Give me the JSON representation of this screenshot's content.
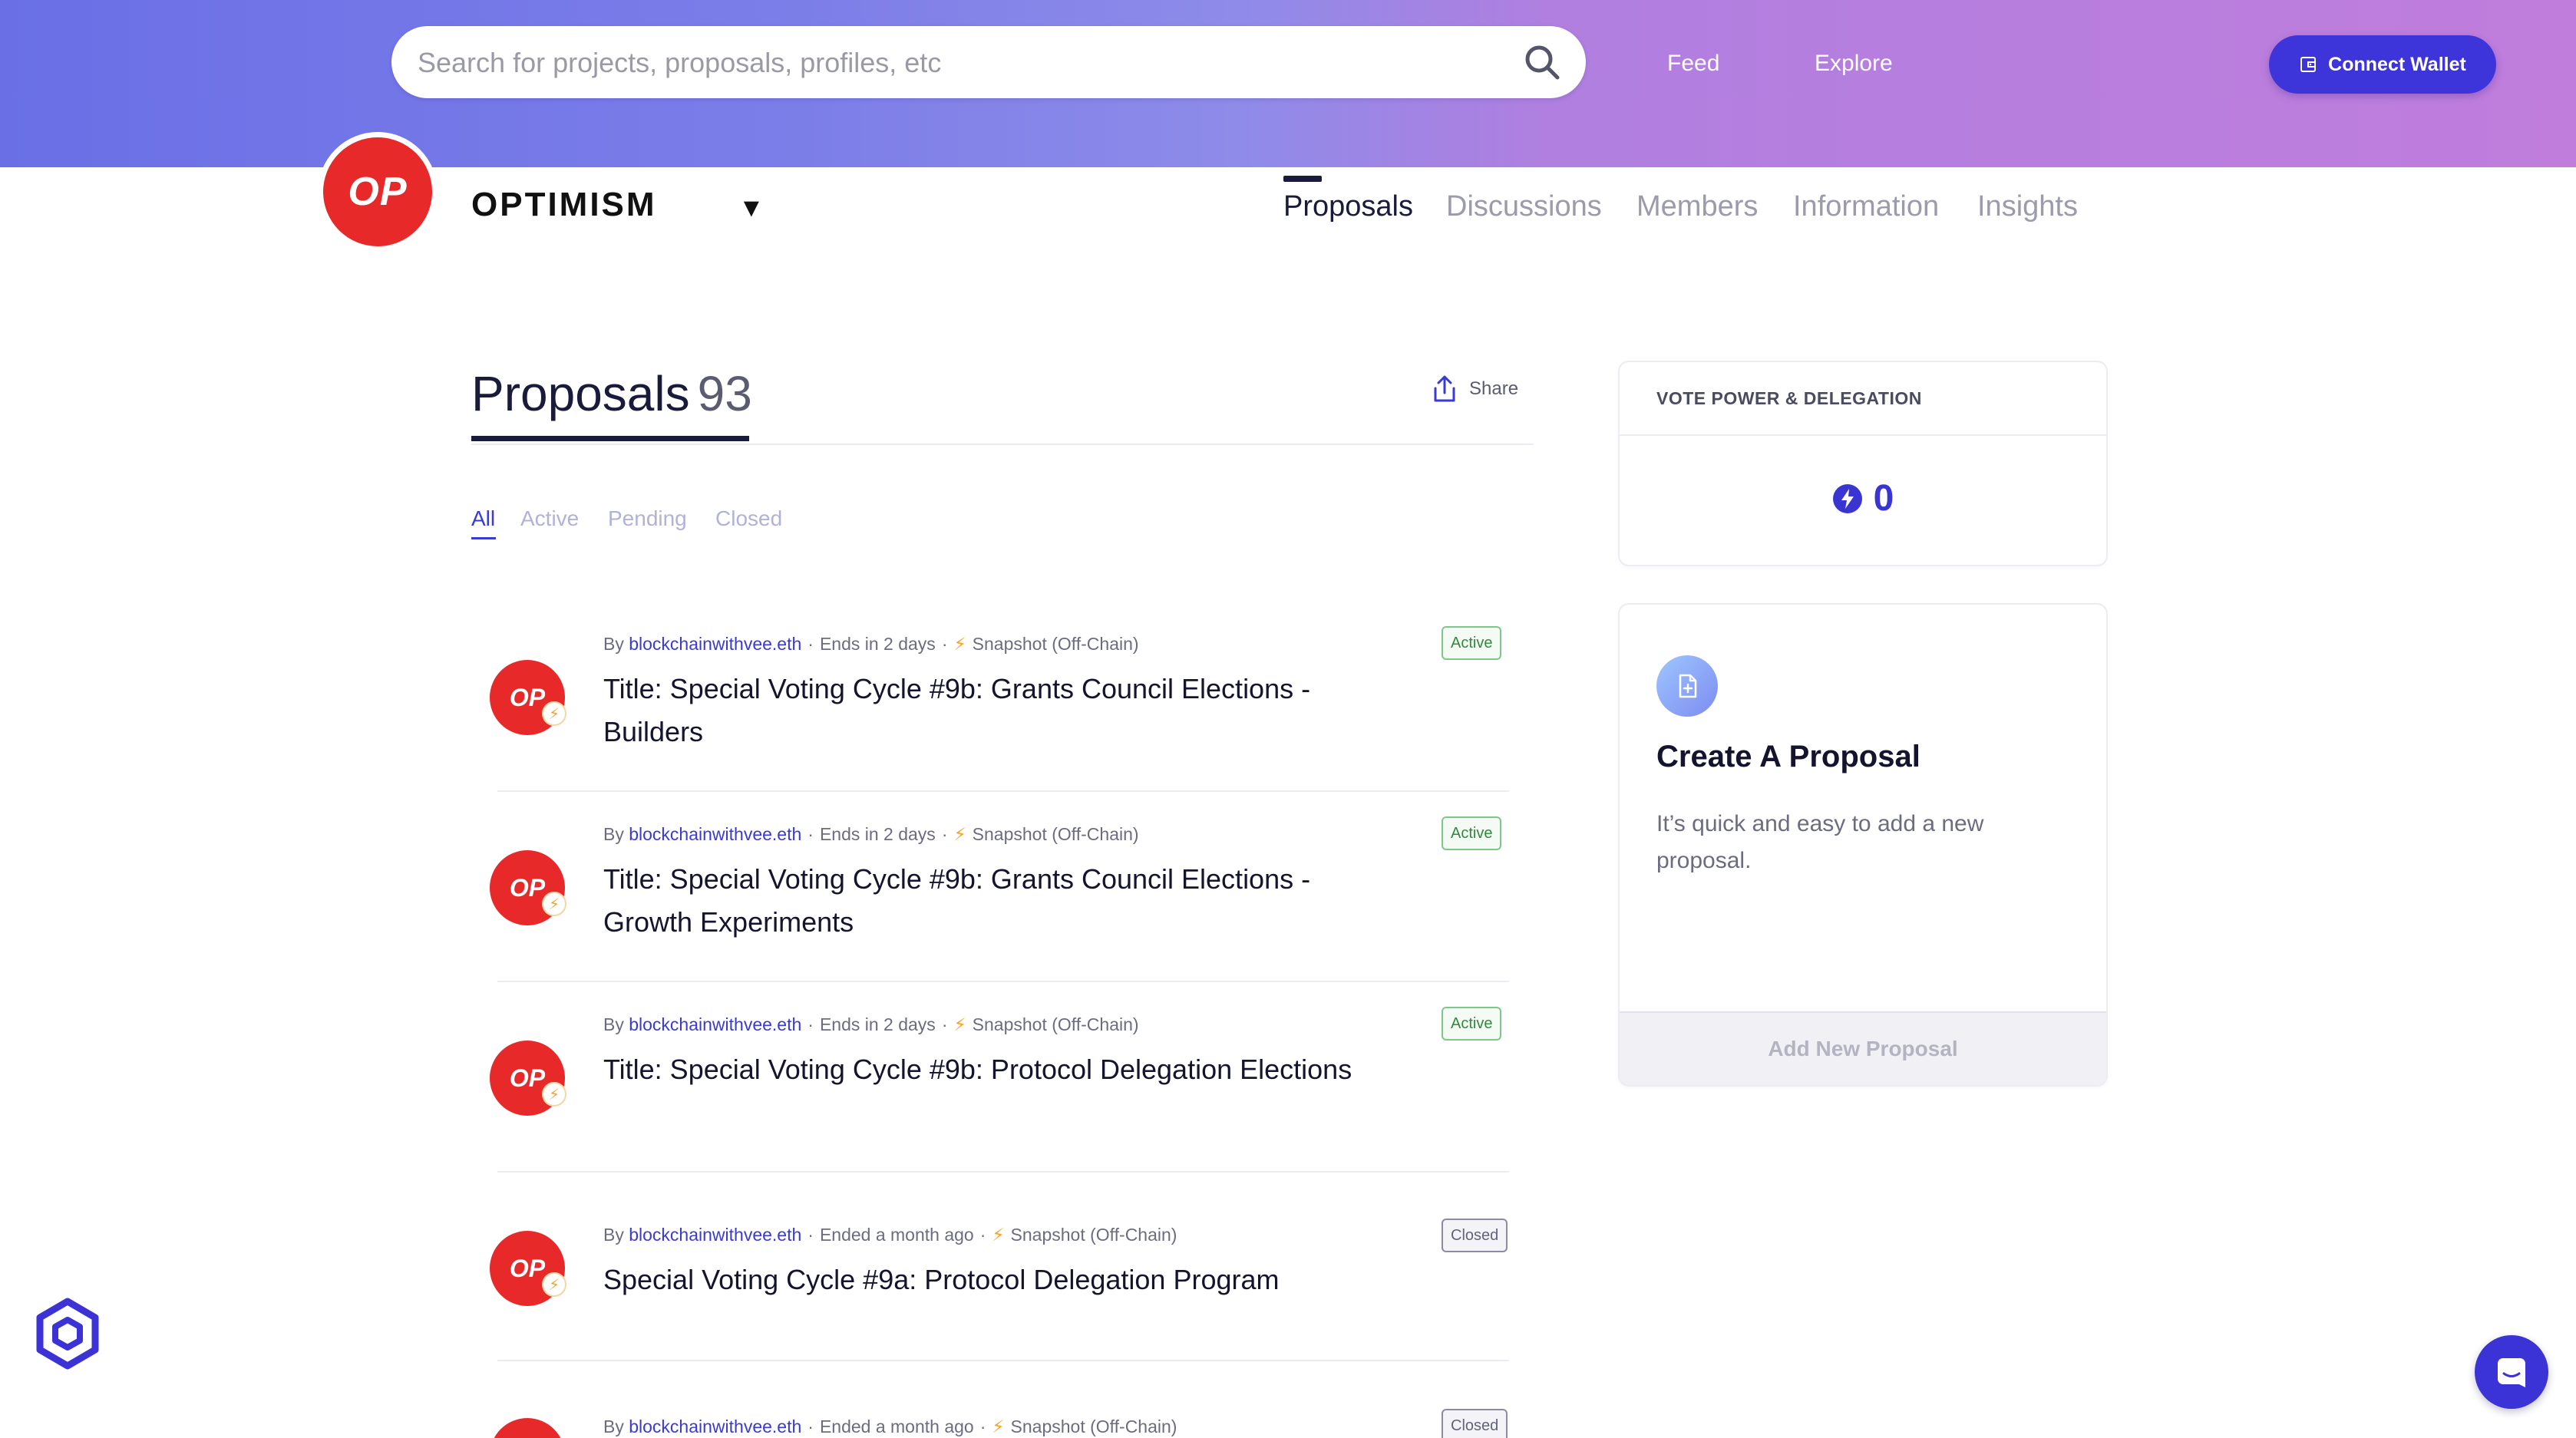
{
  "header": {
    "search_placeholder": "Search for projects, proposals, profiles, etc",
    "nav": [
      "Feed",
      "Explore"
    ],
    "connect_wallet": "Connect Wallet",
    "gradient_colors": [
      "#6a6fe6",
      "#c07ddc"
    ]
  },
  "org": {
    "logo_text": "OP",
    "name": "OPTIMISM",
    "caret": "▼",
    "tabs": [
      "Proposals",
      "Discussions",
      "Members",
      "Information",
      "Insights"
    ],
    "active_tab": "Proposals",
    "brand_color": "#e8292a"
  },
  "proposals": {
    "title": "Proposals",
    "count": "93",
    "share_label": "Share",
    "filters": [
      "All",
      "Active",
      "Pending",
      "Closed"
    ],
    "active_filter": "All",
    "items": [
      {
        "avatar": "OP",
        "by": "By",
        "author": "blockchainwithvee.eth",
        "time": "Ends in 2 days",
        "source": "Snapshot (Off-Chain)",
        "title": "Title: Special Voting Cycle #9b: Grants Council Elections - Builders",
        "status": "Active"
      },
      {
        "avatar": "OP",
        "by": "By",
        "author": "blockchainwithvee.eth",
        "time": "Ends in 2 days",
        "source": "Snapshot (Off-Chain)",
        "title": "Title: Special Voting Cycle #9b: Grants Council Elections - Growth Experiments",
        "status": "Active"
      },
      {
        "avatar": "OP",
        "by": "By",
        "author": "blockchainwithvee.eth",
        "time": "Ends in 2 days",
        "source": "Snapshot (Off-Chain)",
        "title": "Title: Special Voting Cycle #9b: Protocol Delegation Elections",
        "status": "Active"
      },
      {
        "avatar": "OP",
        "by": "By",
        "author": "blockchainwithvee.eth",
        "time": "Ended a month ago",
        "source": "Snapshot (Off-Chain)",
        "title": "Special Voting Cycle #9a: Protocol Delegation Program",
        "status": "Closed"
      },
      {
        "avatar": "OP",
        "by": "By",
        "author": "blockchainwithvee.eth",
        "time": "Ended a month ago",
        "source": "Snapshot (Off-Chain)",
        "title": "",
        "status": "Closed"
      }
    ]
  },
  "sidebar": {
    "vote_power": {
      "heading": "VOTE POWER & DELEGATION",
      "value": "0",
      "icon": "lightning-icon"
    },
    "create_proposal": {
      "icon": "document-plus-icon",
      "title": "Create A Proposal",
      "description": "It’s quick and easy to add a new proposal.",
      "button": "Add New Proposal"
    }
  },
  "widgets": {
    "bottom_left_icon": "hexagon-logo-icon",
    "chat_icon": "chat-icon"
  }
}
